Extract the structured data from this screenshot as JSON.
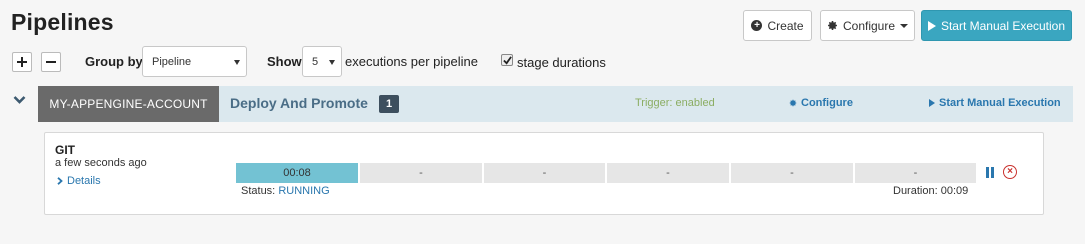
{
  "page": {
    "title": "Pipelines"
  },
  "toolbar": {
    "create_label": "Create",
    "configure_label": "Configure",
    "start_manual_label": "Start Manual Execution"
  },
  "controls": {
    "group_by_label": "Group by",
    "group_by_value": "Pipeline",
    "show_label": "Show",
    "show_value": "5",
    "executions_label": "executions per pipeline",
    "stage_durations_label": "stage durations",
    "stage_durations_checked": true
  },
  "pipeline": {
    "account": "MY-APPENGINE-ACCOUNT",
    "name": "Deploy And Promote",
    "count": "1",
    "trigger_status": "Trigger: enabled",
    "configure_label": "Configure",
    "start_manual_label": "Start Manual Execution"
  },
  "execution": {
    "trigger": "GIT",
    "time": "a few seconds ago",
    "details_label": "Details",
    "stages": [
      {
        "label": "00:08",
        "state": "running"
      },
      {
        "label": "-",
        "state": "not_started"
      },
      {
        "label": "-",
        "state": "not_started"
      },
      {
        "label": "-",
        "state": "not_started"
      },
      {
        "label": "-",
        "state": "not_started"
      },
      {
        "label": "-",
        "state": "not_started"
      }
    ],
    "status_label": "Status:",
    "status_value": "RUNNING",
    "duration_label": "Duration:",
    "duration_value": "00:09"
  },
  "colors": {
    "accent": "#3aa6c0",
    "running_stage": "#73c2d3",
    "link": "#2a77ae",
    "trigger_enabled": "#8bad62",
    "cancel": "#c9302c"
  },
  "icons": [
    "plus-circle-icon",
    "gear-icon",
    "play-icon",
    "chevron-down-icon",
    "chevron-right-icon",
    "pause-icon",
    "cancel-icon",
    "plus-icon",
    "minus-icon",
    "checkmark-icon"
  ]
}
